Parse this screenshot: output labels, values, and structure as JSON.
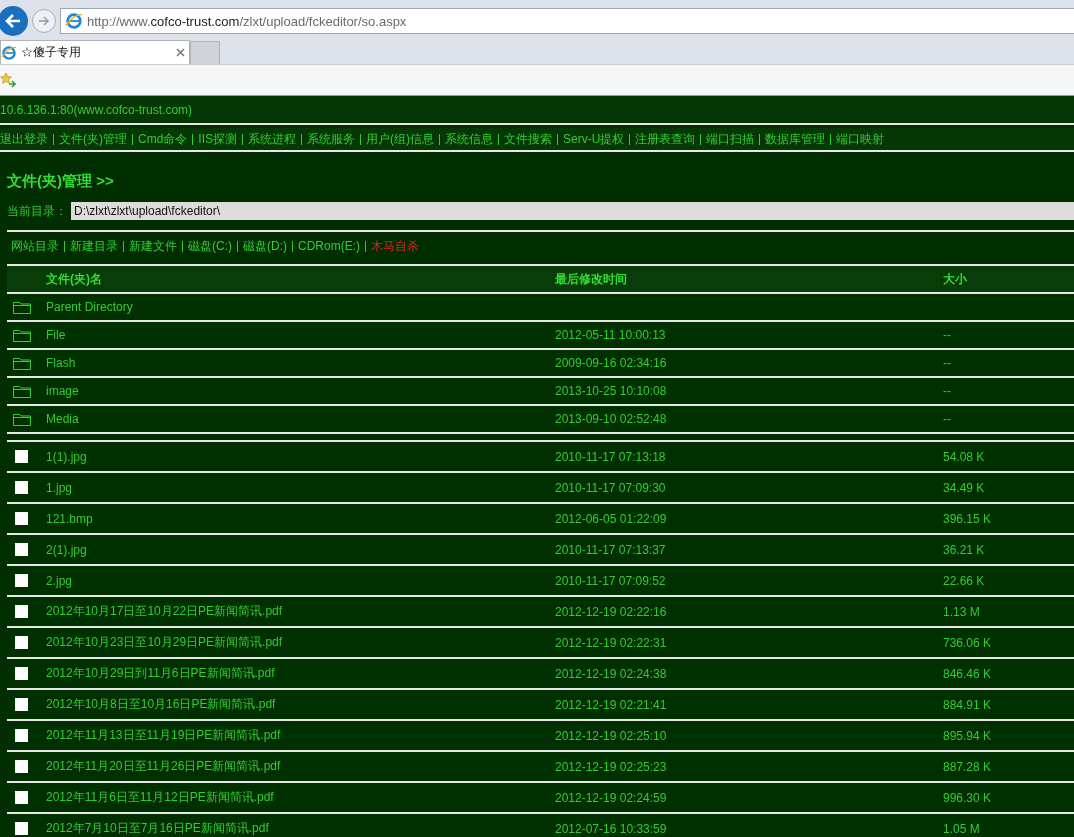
{
  "browser": {
    "url": "http://www.**cofco-trust.com**/zlxt/upload/fckeditor/so.aspx",
    "tabs": [
      {
        "title": "☆傻子专用",
        "selected": true
      }
    ]
  },
  "host": "10.6.136.1:80(www.cofco-trust.com)",
  "nav": [
    "退出登录",
    "文件(夹)管理",
    "Cmd命令",
    "IIS探测",
    "系统进程",
    "系统服务",
    "用户(组)信息",
    "系统信息",
    "文件搜索",
    "Serv-U提权",
    "注册表查询",
    "端口扫描",
    "数据库管理",
    "端口映射"
  ],
  "section_title": "文件(夹)管理 >>",
  "current_dir": {
    "label": "当前目录：",
    "value": "D:\\zlxt\\zlxt\\upload\\fckeditor\\"
  },
  "actions": [
    {
      "label": "网站目录",
      "kind": "normal"
    },
    {
      "label": "新建目录",
      "kind": "normal"
    },
    {
      "label": "新建文件",
      "kind": "normal"
    },
    {
      "label": "磁盘(C:)",
      "kind": "normal"
    },
    {
      "label": "磁盘(D:)",
      "kind": "normal"
    },
    {
      "label": "CDRom(E:)",
      "kind": "normal"
    },
    {
      "label": "木马自杀",
      "kind": "danger"
    }
  ],
  "table": {
    "columns": [
      "文件(夹)名",
      "最后修改时间",
      "大小"
    ],
    "folders": [
      {
        "name": "Parent Directory"
      },
      {
        "name": "File",
        "modified": "2012-05-11 10:00:13",
        "size": "--"
      },
      {
        "name": "Flash",
        "modified": "2009-09-16 02:34:16",
        "size": "--"
      },
      {
        "name": "image",
        "modified": "2013-10-25 10:10:08",
        "size": "--"
      },
      {
        "name": "Media",
        "modified": "2013-09-10 02:52:48",
        "size": "--"
      }
    ],
    "files": [
      {
        "name": "1(1).jpg",
        "modified": "2010-11-17 07:13:18",
        "size": "54.08 K",
        "checked": false
      },
      {
        "name": "1.jpg",
        "modified": "2010-11-17 07:09:30",
        "size": "34.49 K",
        "checked": false
      },
      {
        "name": "121.bmp",
        "modified": "2012-06-05 01:22:09",
        "size": "396.15 K",
        "checked": false
      },
      {
        "name": "2(1).jpg",
        "modified": "2010-11-17 07:13:37",
        "size": "36.21 K",
        "checked": false
      },
      {
        "name": "2.jpg",
        "modified": "2010-11-17 07:09:52",
        "size": "22.66 K",
        "checked": false
      },
      {
        "name": "2012年10月17日至10月22日PE新闻简讯.pdf",
        "modified": "2012-12-19 02:22:16",
        "size": "1.13 M",
        "checked": false
      },
      {
        "name": "2012年10月23日至10月29日PE新闻简讯.pdf",
        "modified": "2012-12-19 02:22:31",
        "size": "736.06 K",
        "checked": false
      },
      {
        "name": "2012年10月29日到11月6日PE新闻简讯.pdf",
        "modified": "2012-12-19 02:24:38",
        "size": "846.46 K",
        "checked": false
      },
      {
        "name": "2012年10月8日至10月16日PE新闻简讯.pdf",
        "modified": "2012-12-19 02:21:41",
        "size": "884.91 K",
        "checked": false
      },
      {
        "name": "2012年11月13日至11月19日PE新闻简讯.pdf",
        "modified": "2012-12-19 02:25:10",
        "size": "895.94 K",
        "checked": false
      },
      {
        "name": "2012年11月20日至11月26日PE新闻简讯.pdf",
        "modified": "2012-12-19 02:25:23",
        "size": "887.28 K",
        "checked": false
      },
      {
        "name": "2012年11月6日至11月12日PE新闻简讯.pdf",
        "modified": "2012-12-19 02:24:59",
        "size": "996.30 K",
        "checked": false
      },
      {
        "name": "2012年7月10日至7月16日PE新闻简讯.pdf",
        "modified": "2012-07-16 10:33:59",
        "size": "1.05 M",
        "checked": false
      }
    ]
  }
}
